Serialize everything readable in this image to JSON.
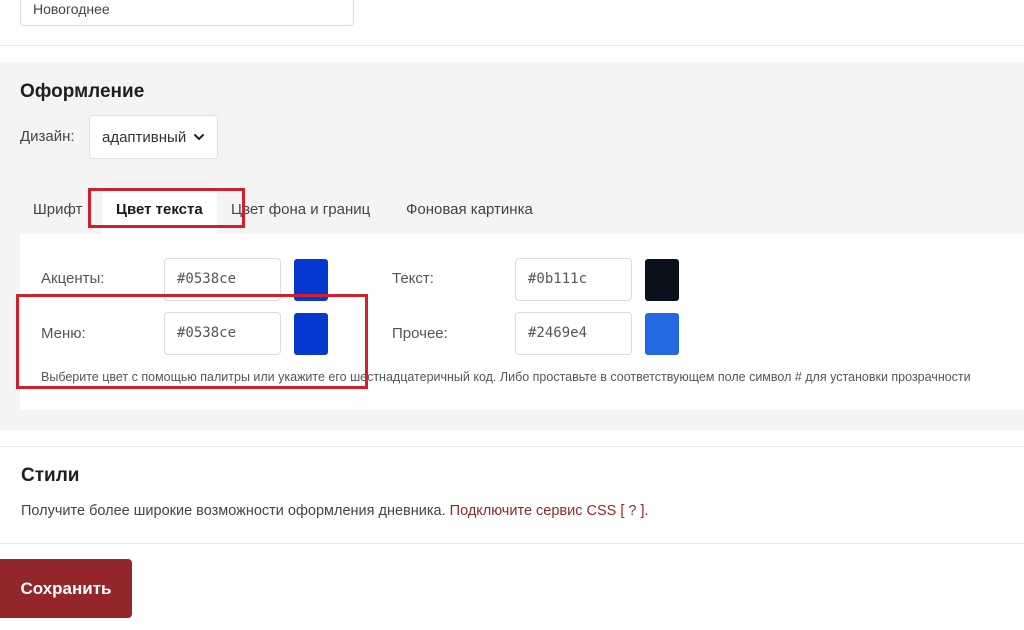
{
  "top": {
    "name_value": "Новогоднее"
  },
  "design": {
    "title": "Оформление",
    "design_label": "Дизайн:",
    "design_value": "адаптивный",
    "tabs": [
      {
        "label": "Шрифт"
      },
      {
        "label": "Цвет текста",
        "active": true
      },
      {
        "label": "Цвет фона и границ"
      },
      {
        "label": "Фоновая картинка"
      }
    ],
    "colors": {
      "accents": {
        "label": "Акценты:",
        "value": "#0538ce",
        "color": "#0538ce"
      },
      "menu": {
        "label": "Меню:",
        "value": "#0538ce",
        "color": "#0538ce"
      },
      "text": {
        "label": "Текст:",
        "value": "#0b111c",
        "color": "#0b111c"
      },
      "other": {
        "label": "Прочее:",
        "value": "#2469e4",
        "color": "#2469e4"
      }
    },
    "hint": "Выберите цвет с помощью палитры или укажите его шестнадцатеричный код. Либо проставьте в соответствующем поле символ # для установки прозрачности"
  },
  "styles": {
    "title": "Стили",
    "text": "Получите более широкие возможности оформления дневника.",
    "link": "Подключите сервис CSS",
    "help": "[ ? ]",
    "period": "."
  },
  "actions": {
    "save_label": "Сохранить"
  },
  "theme": {
    "annotation_color": "#d0202e",
    "button_color": "#92262b",
    "link_color": "#8c2a2a"
  },
  "icons": {
    "dropdown": "chevron-down-icon"
  }
}
